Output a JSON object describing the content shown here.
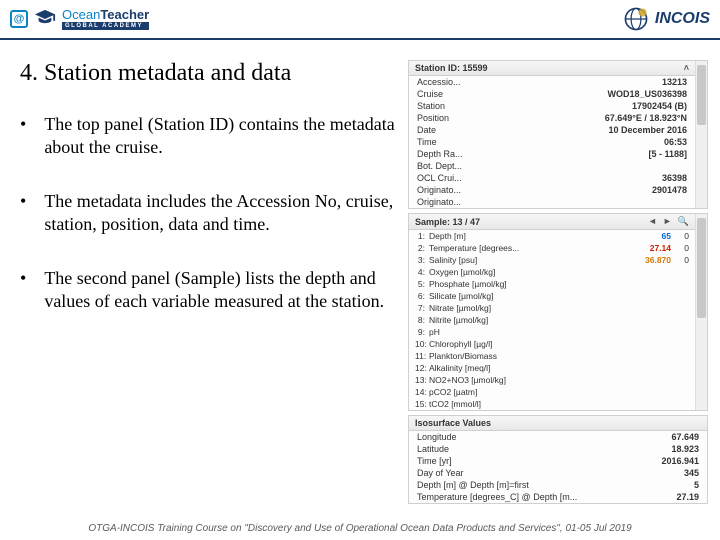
{
  "header": {
    "logo_left_line1_a": "Ocean",
    "logo_left_line1_b": "Teacher",
    "logo_left_line2": "GLOBAL ACADEMY",
    "logo_right": "INCOIS"
  },
  "title": "4. Station metadata and data",
  "bullets": [
    "The top panel (Station ID) contains the metadata about the cruise.",
    "The metadata includes the Accession No, cruise, station, position, data and time.",
    "The second panel (Sample) lists the depth and values of each variable measured at the station."
  ],
  "panels": {
    "station": {
      "title": "Station ID: 15599",
      "rows": [
        {
          "k": "Accessio...",
          "v": "13213"
        },
        {
          "k": "Cruise",
          "v": "WOD18_US036398"
        },
        {
          "k": "Station",
          "v": "17902454 (B)"
        },
        {
          "k": "Position",
          "v": "67.649°E / 18.923°N"
        },
        {
          "k": "Date",
          "v": "10 December 2016"
        },
        {
          "k": "Time",
          "v": "06:53"
        },
        {
          "k": "Depth Ra...",
          "v": "[5 - 1188]"
        },
        {
          "k": "Bot. Dept...",
          "v": ""
        },
        {
          "k": "OCL Crui...",
          "v": "36398"
        },
        {
          "k": "Originato...",
          "v": "2901478"
        },
        {
          "k": "Originato...",
          "v": ""
        }
      ]
    },
    "sample": {
      "title": "Sample: 13 / 47",
      "rows": [
        {
          "n": "1",
          "lbl": "Depth [m]",
          "v": "65",
          "q": "0",
          "cls": "hl-blue"
        },
        {
          "n": "2",
          "lbl": "Temperature [degrees...",
          "v": "27.14",
          "q": "0",
          "cls": "hl-red"
        },
        {
          "n": "3",
          "lbl": "Salinity [psu]",
          "v": "36.870",
          "q": "0",
          "cls": "hl-or"
        },
        {
          "n": "4",
          "lbl": "Oxygen [µmol/kg]",
          "v": "",
          "q": "",
          "cls": ""
        },
        {
          "n": "5",
          "lbl": "Phosphate [µmol/kg]",
          "v": "",
          "q": "",
          "cls": ""
        },
        {
          "n": "6",
          "lbl": "Silicate [µmol/kg]",
          "v": "",
          "q": "",
          "cls": ""
        },
        {
          "n": "7",
          "lbl": "Nitrate [µmol/kg]",
          "v": "",
          "q": "",
          "cls": ""
        },
        {
          "n": "8",
          "lbl": "Nitrite [µmol/kg]",
          "v": "",
          "q": "",
          "cls": ""
        },
        {
          "n": "9",
          "lbl": "pH",
          "v": "",
          "q": "",
          "cls": ""
        },
        {
          "n": "10",
          "lbl": "Chlorophyll [µg/l]",
          "v": "",
          "q": "",
          "cls": ""
        },
        {
          "n": "11",
          "lbl": "Plankton/Biomass",
          "v": "",
          "q": "",
          "cls": ""
        },
        {
          "n": "12",
          "lbl": "Alkalinity [meq/l]",
          "v": "",
          "q": "",
          "cls": ""
        },
        {
          "n": "13",
          "lbl": "NO2+NO3 [µmol/kg]",
          "v": "",
          "q": "",
          "cls": ""
        },
        {
          "n": "14",
          "lbl": "pCO2 [µatm]",
          "v": "",
          "q": "",
          "cls": ""
        },
        {
          "n": "15",
          "lbl": "tCO2 [mmol/l]",
          "v": "",
          "q": "",
          "cls": ""
        }
      ]
    },
    "iso": {
      "title": "Isosurface Values",
      "rows": [
        {
          "k": "Longitude",
          "v": "67.649"
        },
        {
          "k": "Latitude",
          "v": "18.923"
        },
        {
          "k": "Time [yr]",
          "v": "2016.941"
        },
        {
          "k": "Day of Year",
          "v": "345"
        },
        {
          "k": "Depth [m] @ Depth [m]=first",
          "v": "5"
        },
        {
          "k": "Temperature [degrees_C] @ Depth [m...",
          "v": "27.19"
        }
      ]
    }
  },
  "footer": "OTGA-INCOIS Training Course on \"Discovery and Use of Operational Ocean Data Products and Services\", 01-05 Jul 2019"
}
